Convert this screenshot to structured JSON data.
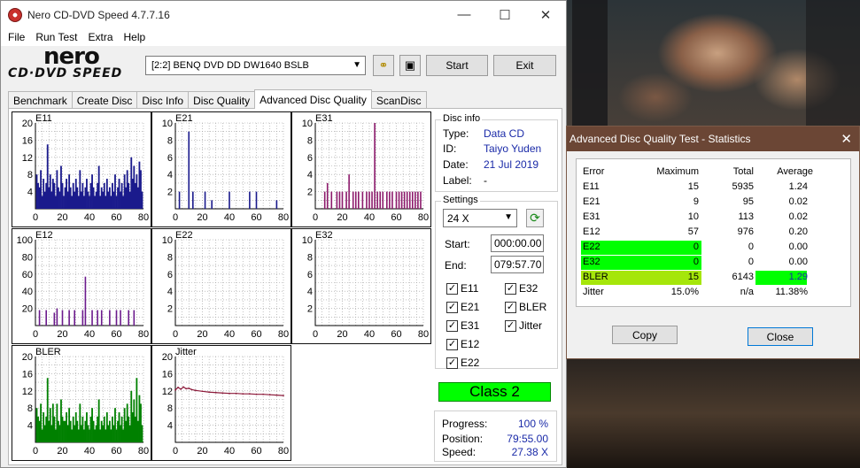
{
  "window": {
    "title": "Nero CD-DVD Speed 4.7.7.16",
    "minimize": "—",
    "maximize": "☐",
    "close": "✕"
  },
  "menu": [
    "File",
    "Run Test",
    "Extra",
    "Help"
  ],
  "logo": {
    "brand": "nero",
    "sub": "CD·DVD SPEED"
  },
  "toolbar": {
    "drive": "[2:2]   BENQ DVD DD DW1640 BSLB",
    "start": "Start",
    "exit": "Exit"
  },
  "tabs": [
    "Benchmark",
    "Create Disc",
    "Disc Info",
    "Disc Quality",
    "Advanced Disc Quality",
    "ScanDisc"
  ],
  "active_tab": "Advanced Disc Quality",
  "disc_info": {
    "title": "Disc info",
    "type_label": "Type:",
    "type": "Data CD",
    "id_label": "ID:",
    "id": "Taiyo Yuden",
    "date_label": "Date:",
    "date": "21 Jul 2019",
    "label_label": "Label:",
    "label": "-"
  },
  "settings": {
    "title": "Settings",
    "speed": "24 X",
    "start_label": "Start:",
    "start": "000:00.00",
    "end_label": "End:",
    "end": "079:57.70",
    "checkboxes": [
      {
        "label": "E11",
        "checked": true
      },
      {
        "label": "E32",
        "checked": true
      },
      {
        "label": "E21",
        "checked": true
      },
      {
        "label": "BLER",
        "checked": true
      },
      {
        "label": "E31",
        "checked": true
      },
      {
        "label": "Jitter",
        "checked": true
      },
      {
        "label": "E12",
        "checked": true
      },
      {
        "label": "E22",
        "checked": true
      }
    ]
  },
  "class_badge": "Class 2",
  "progress": {
    "progress_label": "Progress:",
    "progress": "100 %",
    "position_label": "Position:",
    "position": "79:55.00",
    "speed_label": "Speed:",
    "speed": "27.38 X"
  },
  "chart_data": [
    {
      "type": "bar",
      "name": "E11",
      "ylim": [
        0,
        20
      ],
      "yticks": [
        4,
        8,
        12,
        16,
        20
      ],
      "xticks": [
        0,
        20,
        40,
        60,
        80
      ],
      "color": "#1a1a8c",
      "x": [
        1,
        2,
        3,
        4,
        5,
        6,
        7,
        8,
        9,
        10,
        11,
        12,
        13,
        14,
        15,
        16,
        17,
        18,
        19,
        20,
        21,
        22,
        23,
        24,
        25,
        26,
        27,
        28,
        29,
        30,
        31,
        32,
        33,
        34,
        35,
        36,
        37,
        38,
        39,
        40,
        41,
        42,
        43,
        44,
        45,
        46,
        47,
        48,
        49,
        50,
        51,
        52,
        53,
        54,
        55,
        56,
        57,
        58,
        59,
        60,
        61,
        62,
        63,
        64,
        65,
        66,
        67,
        68,
        69,
        70,
        71,
        72,
        73,
        74,
        75,
        76,
        77,
        78,
        79
      ],
      "values": [
        8,
        6,
        5,
        9,
        3,
        7,
        4,
        6,
        15,
        5,
        8,
        4,
        7,
        6,
        3,
        9,
        5,
        4,
        10,
        6,
        3,
        5,
        7,
        4,
        8,
        5,
        3,
        6,
        4,
        7,
        5,
        3,
        9,
        4,
        6,
        3,
        5,
        7,
        4,
        3,
        6,
        8,
        5,
        3,
        4,
        6,
        10,
        3,
        5,
        4,
        6,
        3,
        7,
        4,
        5,
        3,
        6,
        4,
        8,
        3,
        5,
        7,
        4,
        6,
        3,
        8,
        5,
        9,
        6,
        4,
        12,
        7,
        10,
        6,
        8,
        5,
        11,
        9,
        4
      ]
    },
    {
      "type": "bar",
      "name": "E21",
      "ylim": [
        0,
        10
      ],
      "yticks": [
        2,
        4,
        6,
        8,
        10
      ],
      "xticks": [
        0,
        20,
        40,
        60,
        80
      ],
      "color": "#1a1a8c",
      "x": [
        3,
        10,
        13,
        22,
        27,
        40,
        55,
        60,
        75
      ],
      "values": [
        2,
        9,
        2,
        2,
        1,
        2,
        2,
        2,
        1
      ]
    },
    {
      "type": "bar",
      "name": "E31",
      "ylim": [
        0,
        10
      ],
      "yticks": [
        2,
        4,
        6,
        8,
        10
      ],
      "xticks": [
        0,
        20,
        40,
        60,
        80
      ],
      "color": "#8c1a6b",
      "x": [
        7,
        9,
        12,
        16,
        18,
        20,
        23,
        25,
        28,
        30,
        32,
        35,
        38,
        40,
        42,
        44,
        46,
        48,
        50,
        53,
        55,
        57,
        60,
        62,
        64,
        66,
        68,
        70,
        72,
        74,
        76,
        78
      ],
      "values": [
        2,
        3,
        2,
        2,
        2,
        2,
        2,
        4,
        2,
        2,
        2,
        2,
        2,
        2,
        2,
        10,
        2,
        2,
        2,
        2,
        2,
        2,
        2,
        2,
        2,
        2,
        2,
        2,
        2,
        2,
        2,
        2
      ]
    },
    {
      "type": "bar",
      "name": "E12",
      "ylim": [
        0,
        100
      ],
      "yticks": [
        20,
        40,
        60,
        80,
        100
      ],
      "xticks": [
        0,
        20,
        40,
        60,
        80
      ],
      "color": "#6b1a8c",
      "x": [
        3,
        8,
        14,
        16,
        20,
        25,
        29,
        35,
        37,
        42,
        46,
        49,
        55,
        60,
        63,
        69,
        73
      ],
      "values": [
        18,
        18,
        15,
        20,
        18,
        18,
        18,
        18,
        57,
        18,
        18,
        18,
        18,
        18,
        18,
        18,
        18
      ]
    },
    {
      "type": "bar",
      "name": "E22",
      "ylim": [
        0,
        10
      ],
      "yticks": [
        2,
        4,
        6,
        8,
        10
      ],
      "xticks": [
        0,
        20,
        40,
        60,
        80
      ],
      "color": "#1a1a8c",
      "x": [],
      "values": []
    },
    {
      "type": "bar",
      "name": "E32",
      "ylim": [
        0,
        10
      ],
      "yticks": [
        2,
        4,
        6,
        8,
        10
      ],
      "xticks": [
        0,
        20,
        40,
        60,
        80
      ],
      "color": "#1a1a8c",
      "x": [],
      "values": []
    },
    {
      "type": "bar",
      "name": "BLER",
      "ylim": [
        0,
        20
      ],
      "yticks": [
        4,
        8,
        12,
        16,
        20
      ],
      "xticks": [
        0,
        20,
        40,
        60,
        80
      ],
      "color": "#008000",
      "x": [
        1,
        2,
        3,
        4,
        5,
        6,
        7,
        8,
        9,
        10,
        11,
        12,
        13,
        14,
        15,
        16,
        17,
        18,
        19,
        20,
        21,
        22,
        23,
        24,
        25,
        26,
        27,
        28,
        29,
        30,
        31,
        32,
        33,
        34,
        35,
        36,
        37,
        38,
        39,
        40,
        41,
        42,
        43,
        44,
        45,
        46,
        47,
        48,
        49,
        50,
        51,
        52,
        53,
        54,
        55,
        56,
        57,
        58,
        59,
        60,
        61,
        62,
        63,
        64,
        65,
        66,
        67,
        68,
        69,
        70,
        71,
        72,
        73,
        74,
        75,
        76,
        77,
        78,
        79
      ],
      "values": [
        8,
        6,
        5,
        9,
        3,
        7,
        4,
        6,
        15,
        5,
        8,
        4,
        9,
        6,
        3,
        9,
        5,
        4,
        10,
        6,
        5,
        5,
        7,
        4,
        8,
        5,
        3,
        6,
        4,
        7,
        5,
        3,
        9,
        4,
        6,
        3,
        5,
        7,
        4,
        3,
        6,
        8,
        5,
        3,
        4,
        6,
        10,
        3,
        5,
        4,
        6,
        3,
        7,
        4,
        5,
        3,
        6,
        4,
        8,
        3,
        5,
        7,
        4,
        6,
        3,
        8,
        5,
        9,
        6,
        4,
        12,
        7,
        10,
        6,
        15,
        5,
        11,
        9,
        4
      ]
    },
    {
      "type": "line",
      "name": "Jitter",
      "ylim": [
        0,
        20
      ],
      "yticks": [
        4,
        8,
        12,
        16,
        20
      ],
      "xticks": [
        0,
        20,
        40,
        60,
        80
      ],
      "color": "#8c1a3a",
      "x": [
        0,
        2,
        4,
        6,
        8,
        10,
        12,
        15,
        20,
        25,
        30,
        35,
        40,
        45,
        50,
        55,
        60,
        65,
        70,
        75,
        80
      ],
      "values": [
        12.2,
        12.8,
        12.4,
        12.9,
        12.5,
        12.6,
        12.3,
        12.1,
        11.9,
        11.7,
        11.6,
        11.5,
        11.4,
        11.4,
        11.3,
        11.3,
        11.2,
        11.2,
        11.1,
        11.0,
        10.9
      ]
    }
  ],
  "stats": {
    "title": "Advanced Disc Quality Test - Statistics",
    "headers": [
      "Error",
      "Maximum",
      "Total",
      "Average"
    ],
    "rows": [
      {
        "error": "E11",
        "maximum": "15",
        "total": "5935",
        "average": "1.24"
      },
      {
        "error": "E21",
        "maximum": "9",
        "total": "95",
        "average": "0.02"
      },
      {
        "error": "E31",
        "maximum": "10",
        "total": "113",
        "average": "0.02"
      },
      {
        "error": "E12",
        "maximum": "57",
        "total": "976",
        "average": "0.20"
      },
      {
        "error": "E22",
        "maximum": "0",
        "total": "0",
        "average": "0.00"
      },
      {
        "error": "E32",
        "maximum": "0",
        "total": "0",
        "average": "0.00"
      },
      {
        "error": "BLER",
        "maximum": "15",
        "total": "6143",
        "average": "1.29"
      },
      {
        "error": "Jitter",
        "maximum": "15.0%",
        "total": "n/a",
        "average": "11.38%"
      }
    ],
    "copy": "Copy",
    "close": "Close"
  },
  "colors": {
    "accent_green": "#00ff00",
    "bler_green": "#a5e60a",
    "value_blue": "#1a2aa8",
    "dialog_title": "#6b4635"
  }
}
